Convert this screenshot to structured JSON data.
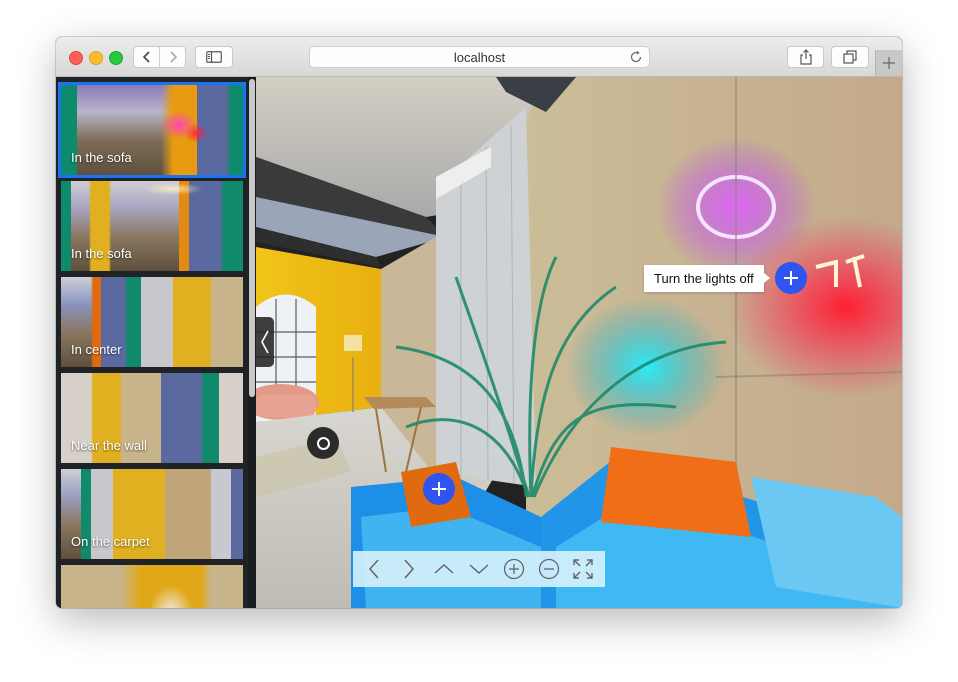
{
  "browser": {
    "url": "localhost",
    "buttons": {
      "back": "back",
      "forward": "forward",
      "sidebar": "sidebar",
      "reload": "reload",
      "share": "share",
      "tabs": "tabs",
      "new_tab": "new-tab"
    }
  },
  "gallery": {
    "items": [
      {
        "label": "In the sofa",
        "active": true
      },
      {
        "label": "In the sofa",
        "active": false
      },
      {
        "label": "In center",
        "active": false
      },
      {
        "label": "Near the wall",
        "active": false
      },
      {
        "label": "On the carpet",
        "active": false
      },
      {
        "label": "",
        "active": false
      }
    ]
  },
  "viewer": {
    "tooltip": "Turn the lights off",
    "accent": "#2f55f0",
    "controls": [
      "move-left",
      "move-right",
      "move-up",
      "move-down",
      "zoom-in",
      "zoom-out",
      "fullscreen"
    ]
  }
}
